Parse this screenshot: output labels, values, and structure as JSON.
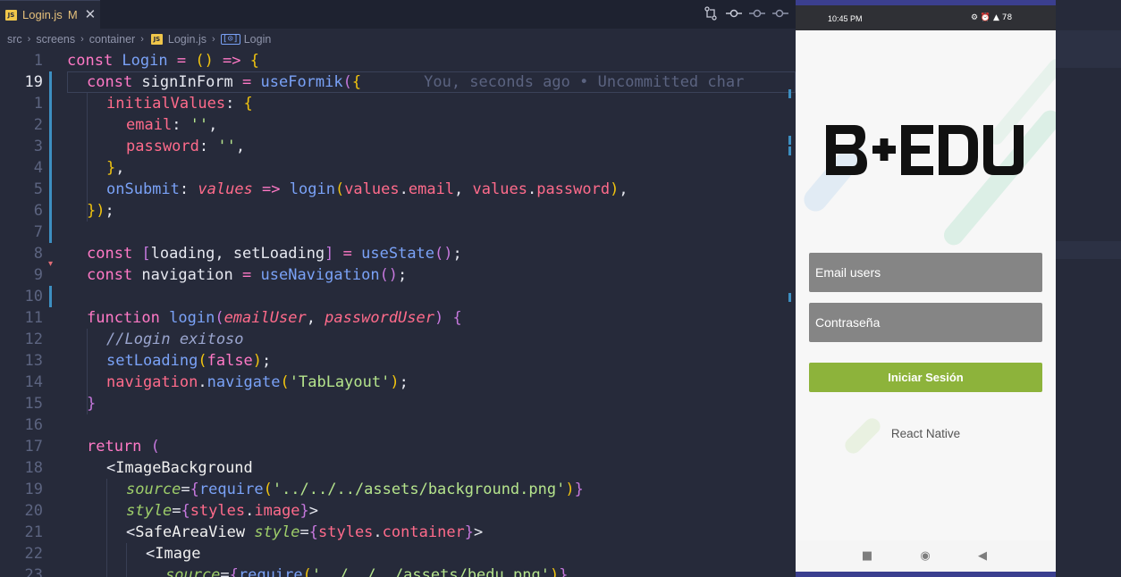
{
  "editor": {
    "tab": {
      "icon": "JS",
      "filename": "Login.js",
      "modified": "M"
    },
    "toolbar_icons": [
      "git-compare-icon",
      "git-commit-icon",
      "go-back-icon",
      "go-forward-icon"
    ],
    "breadcrumb": [
      "src",
      "screens",
      "container",
      "Login.js",
      "Login"
    ],
    "breadcrumb_file_icon": "JS",
    "breadcrumb_symbol_icon": "[⊙]",
    "line_numbers": [
      "1",
      "19",
      "1",
      "2",
      "3",
      "4",
      "5",
      "6",
      "7",
      "8",
      "9",
      "10",
      "11",
      "12",
      "13",
      "14",
      "15",
      "16",
      "17",
      "18",
      "19",
      "20",
      "21",
      "22",
      "23"
    ],
    "current_line_index": 1,
    "blame": "You, seconds ago • Uncommitted char",
    "code": {
      "l0": {
        "a": "const",
        "b": " Login ",
        "c": "=",
        "d": " () ",
        "e": "=>",
        "f": " {"
      },
      "l1": {
        "a": "const",
        "b": " signInForm ",
        "c": "=",
        "d": " useFormik",
        "e": "(",
        "f": "{"
      },
      "l2": {
        "a": "initialValues",
        "b": ": ",
        "c": "{"
      },
      "l3": {
        "a": "email",
        "b": ": ",
        "c": "''",
        "d": ","
      },
      "l4": {
        "a": "password",
        "b": ": ",
        "c": "''",
        "d": ","
      },
      "l5": {
        "a": "}",
        "b": ","
      },
      "l6": {
        "a": "onSubmit",
        "b": ": ",
        "c": "values",
        "d": " => ",
        "e": "login",
        "f": "(",
        "g": "values",
        "h": ".",
        "i": "email",
        "j": ", ",
        "k": "values",
        "l": ".",
        "m": "password",
        "n": ")",
        "o": ","
      },
      "l7": {
        "a": "})",
        "b": ";"
      },
      "l9": {
        "a": "const",
        "b": " [",
        "c": "loading",
        "d": ", ",
        "e": "setLoading",
        "f": "] ",
        "g": "=",
        "h": " useState",
        "i": "()",
        "j": ";"
      },
      "l10": {
        "a": "const",
        "b": " navigation ",
        "c": "=",
        "d": " useNavigation",
        "e": "()",
        "f": ";"
      },
      "l12": {
        "a": "function",
        "b": " login",
        "c": "(",
        "d": "emailUser",
        "e": ", ",
        "f": "passwordUser",
        "g": ")",
        "h": " {"
      },
      "l13": {
        "a": "//Login exitoso"
      },
      "l14": {
        "a": "setLoading",
        "b": "(",
        "c": "false",
        "d": ")",
        "e": ";"
      },
      "l15": {
        "a": "navigation",
        "b": ".",
        "c": "navigate",
        "d": "(",
        "e": "'TabLayout'",
        "f": ")",
        "g": ";"
      },
      "l16": {
        "a": "}"
      },
      "l18": {
        "a": "return",
        "b": " ("
      },
      "l19": {
        "a": "<",
        "b": "ImageBackground"
      },
      "l20": {
        "a": "source",
        "b": "=",
        "c": "{",
        "d": "require",
        "e": "(",
        "f": "'../../../assets/background.png'",
        "g": ")",
        "h": "}"
      },
      "l21": {
        "a": "style",
        "b": "=",
        "c": "{",
        "d": "styles",
        "e": ".",
        "f": "image",
        "g": "}",
        "h": ">"
      },
      "l22": {
        "a": "<",
        "b": "SafeAreaView",
        "c": " style",
        "d": "=",
        "e": "{",
        "f": "styles",
        "g": ".",
        "h": "container",
        "i": "}",
        "j": ">"
      },
      "l23": {
        "a": "<",
        "b": "Image"
      },
      "l24": {
        "a": "source",
        "b": "=",
        "c": "{",
        "d": "require",
        "e": "(",
        "f": "'../../../assets/bedu.png'",
        "g": ")",
        "h": "}"
      }
    }
  },
  "phone": {
    "status_time": "10:45 PM",
    "status_right": "⚙ ⏰ ▲ 78",
    "logo_text": "BEDU",
    "email_placeholder": "Email users",
    "password_placeholder": "Contraseña",
    "login_button": "Iniciar Sesión",
    "footer": "React Native",
    "accent_color": "#8db33b",
    "nav_icons": [
      "square-icon",
      "circle-icon",
      "triangle-back-icon"
    ]
  }
}
